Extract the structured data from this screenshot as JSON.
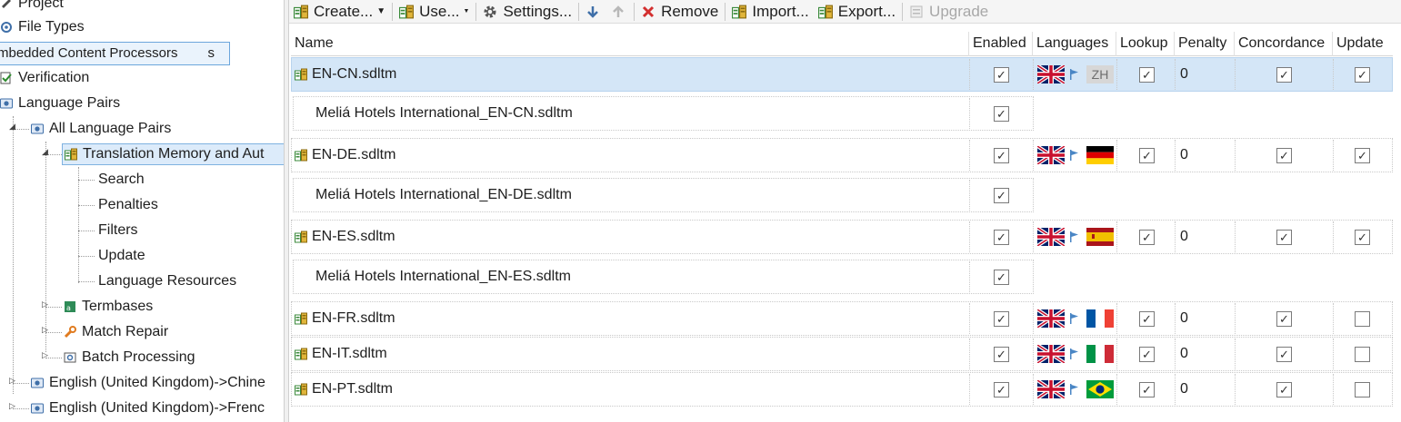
{
  "tree": {
    "items": [
      {
        "label": "Project",
        "icon": "project-icon"
      },
      {
        "label": "File Types",
        "icon": "file-types-icon"
      },
      {
        "label": "Verification",
        "icon": "verification-icon"
      },
      {
        "label": "Language Pairs",
        "icon": "language-pairs-icon"
      },
      {
        "label": "All Language Pairs",
        "icon": "language-pairs-icon"
      },
      {
        "label": "Translation Memory and Aut",
        "icon": "translation-memory-icon"
      },
      {
        "label": "Search"
      },
      {
        "label": "Penalties"
      },
      {
        "label": "Filters"
      },
      {
        "label": "Update"
      },
      {
        "label": "Language Resources"
      },
      {
        "label": "Termbases",
        "icon": "termbase-icon"
      },
      {
        "label": "Match Repair",
        "icon": "wrench-icon"
      },
      {
        "label": "Batch Processing",
        "icon": "batch-processing-icon"
      },
      {
        "label": "English (United Kingdom)->Chine",
        "icon": "language-pairs-icon"
      },
      {
        "label": "English (United Kingdom)->Frenc",
        "icon": "language-pairs-icon"
      }
    ],
    "tooltip": {
      "text": "mbedded Content Processors",
      "tail": "s"
    }
  },
  "toolbar": {
    "create": "Create...",
    "use": "Use...",
    "settings": "Settings...",
    "remove": "Remove",
    "import": "Import...",
    "export": "Export...",
    "upgrade": "Upgrade"
  },
  "grid": {
    "headers": {
      "name": "Name",
      "enabled": "Enabled",
      "languages": "Languages",
      "lookup": "Lookup",
      "penalty": "Penalty",
      "concordance": "Concordance",
      "update": "Update"
    },
    "rows": [
      {
        "name": "EN-CN.sdltm",
        "enabled": true,
        "target": "ZH",
        "lookup": true,
        "penalty": "0",
        "concordance": true,
        "update": true
      },
      {
        "child": "Meliá Hotels International_EN-CN.sdltm",
        "enabled": true
      },
      {
        "name": "EN-DE.sdltm",
        "enabled": true,
        "target": "de-flag",
        "lookup": true,
        "penalty": "0",
        "concordance": true,
        "update": true
      },
      {
        "child": "Meliá Hotels International_EN-DE.sdltm",
        "enabled": true
      },
      {
        "name": "EN-ES.sdltm",
        "enabled": true,
        "target": "es-flag",
        "lookup": true,
        "penalty": "0",
        "concordance": true,
        "update": true
      },
      {
        "child": "Meliá Hotels International_EN-ES.sdltm",
        "enabled": true
      },
      {
        "name": "EN-FR.sdltm",
        "enabled": true,
        "target": "fr-flag",
        "lookup": true,
        "penalty": "0",
        "concordance": true,
        "update": false
      },
      {
        "name": "EN-IT.sdltm",
        "enabled": true,
        "target": "it-flag",
        "lookup": true,
        "penalty": "0",
        "concordance": true,
        "update": false
      },
      {
        "name": "EN-PT.sdltm",
        "enabled": true,
        "target": "br-flag",
        "lookup": true,
        "penalty": "0",
        "concordance": true,
        "update": false
      }
    ],
    "check_glyph": "✓"
  },
  "colors": {
    "selection": "#d4e6f7",
    "tree_selection": "#dcebfa",
    "accent": "#4a86c5"
  }
}
